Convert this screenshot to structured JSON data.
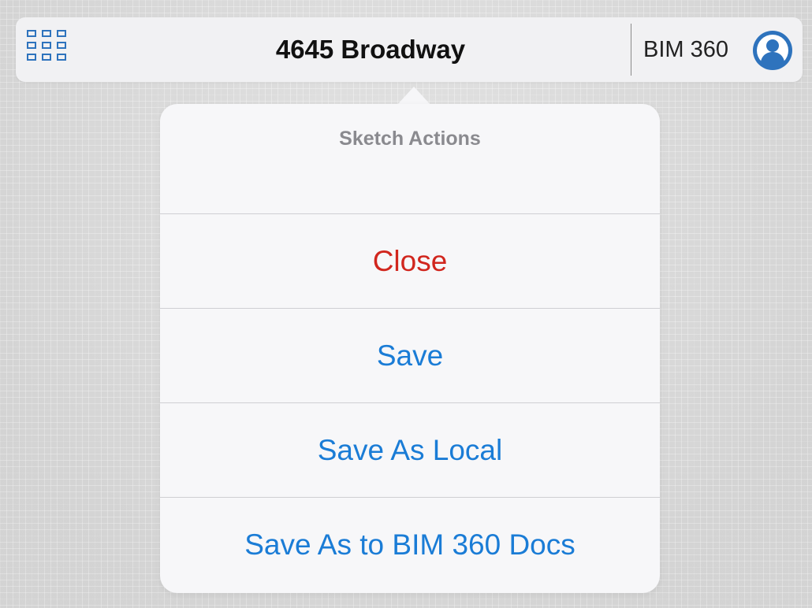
{
  "toolbar": {
    "apps_icon": "grid-apps-icon",
    "project_title": "4645 Broadway",
    "service_label": "BIM 360",
    "avatar_icon": "user-avatar-icon",
    "accent_color": "#2e73bd"
  },
  "sketch_actions": {
    "title": "Sketch Actions",
    "items": [
      {
        "label": "Close",
        "color": "#d1261e",
        "style": "destructive"
      },
      {
        "label": "Save",
        "color": "#1a7cd6",
        "style": "default"
      },
      {
        "label": "Save As Local",
        "color": "#1a7cd6",
        "style": "default"
      },
      {
        "label": "Save As to BIM 360 Docs",
        "color": "#1a7cd6",
        "style": "default"
      }
    ]
  }
}
